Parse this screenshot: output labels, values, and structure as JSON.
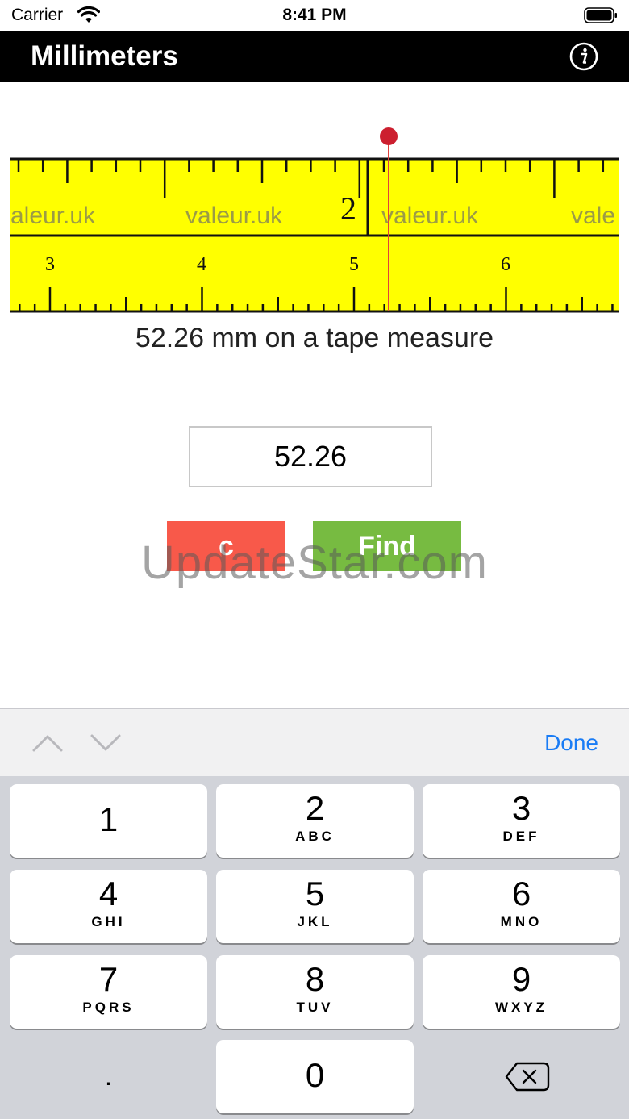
{
  "status_bar": {
    "carrier": "Carrier",
    "time": "8:41 PM"
  },
  "nav": {
    "title": "Millimeters",
    "info_icon": "info-icon"
  },
  "tape": {
    "background_color": "#ffff00",
    "upper_scale_label": "2",
    "brand_text": "valeur.uk",
    "brand_fragments": [
      "aleur.uk",
      "valeur.uk",
      "valeur.uk",
      "vale"
    ],
    "lower_scale_labels": [
      "3",
      "4",
      "5",
      "6"
    ],
    "pointer_color": "#cc1f2f",
    "pointer_value_mm": 52.26
  },
  "caption": "52.26 mm on a tape measure",
  "input": {
    "value": "52.26"
  },
  "buttons": {
    "clear_label": "c",
    "find_label": "Find",
    "clear_color": "#f8594a",
    "find_color": "#77bb41"
  },
  "watermark": "UpdateStar.com",
  "accessory": {
    "done_label": "Done",
    "up_icon": "chevron-up-icon",
    "down_icon": "chevron-down-icon"
  },
  "keypad": {
    "keys": [
      {
        "digit": "1",
        "letters": ""
      },
      {
        "digit": "2",
        "letters": "ABC"
      },
      {
        "digit": "3",
        "letters": "DEF"
      },
      {
        "digit": "4",
        "letters": "GHI"
      },
      {
        "digit": "5",
        "letters": "JKL"
      },
      {
        "digit": "6",
        "letters": "MNO"
      },
      {
        "digit": "7",
        "letters": "PQRS"
      },
      {
        "digit": "8",
        "letters": "TUV"
      },
      {
        "digit": "9",
        "letters": "WXYZ"
      },
      {
        "digit": "0",
        "letters": ""
      }
    ],
    "decimal": ".",
    "delete_icon": "backspace-icon"
  }
}
